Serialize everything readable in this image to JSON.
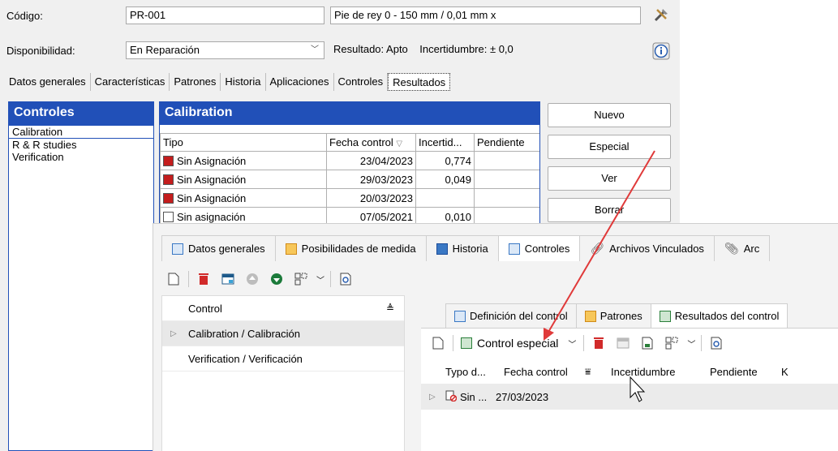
{
  "old": {
    "codigo_label": "Código:",
    "codigo_value": "PR-001",
    "descripcion": "Pie de rey 0 - 150 mm / 0,01 mm x",
    "disponibilidad_label": "Disponibilidad:",
    "disponibilidad_value": "En Reparación",
    "resultado": "Resultado: Apto",
    "incertidumbre": "Incertidumbre: ± 0,0",
    "tabs": [
      "Datos generales",
      "Características",
      "Patrones",
      "Historia",
      "Aplicaciones",
      "Controles",
      "Resultados"
    ],
    "controles_title": "Controles",
    "controles_items": [
      "Calibration",
      "R & R studies",
      "Verification"
    ],
    "calib_title": "Calibration",
    "table_headers": [
      "Tipo",
      "Fecha control",
      "Incertid...",
      "Pendiente"
    ],
    "rows": [
      {
        "tipo": "Sin Asignación",
        "fecha": "23/04/2023",
        "incert": "0,774",
        "pend": ""
      },
      {
        "tipo": "Sin Asignación",
        "fecha": "29/03/2023",
        "incert": "0,049",
        "pend": ""
      },
      {
        "tipo": "Sin Asignación",
        "fecha": "20/03/2023",
        "incert": "",
        "pend": ""
      },
      {
        "tipo": "Sin asignación",
        "fecha": "07/05/2021",
        "incert": "0,010",
        "pend": ""
      }
    ],
    "buttons": [
      "Nuevo",
      "Especial",
      "Ver",
      "Borrar"
    ]
  },
  "new": {
    "tabs": [
      "Datos generales",
      "Posibilidades de medida",
      "Historia",
      "Controles",
      "Archivos Vinculados",
      "Arc"
    ],
    "active_tab": "Controles",
    "left_header": "Control",
    "left_rows": [
      "Calibration / Calibración",
      "Verification / Verificación"
    ],
    "subtabs": [
      "Definición del control",
      "Patrones",
      "Resultados del control"
    ],
    "toolbar_special": "Control especial",
    "res_headers": [
      "Typo d...",
      "Fecha control",
      "Incertidumbre",
      "Pendiente",
      "K"
    ],
    "res_row": {
      "tipo": "Sin ...",
      "fecha": "27/03/2023"
    }
  },
  "colors": {
    "panel_header": "#2150b8",
    "delete_red": "#d12a2a",
    "arrow": "#e03a3a"
  }
}
